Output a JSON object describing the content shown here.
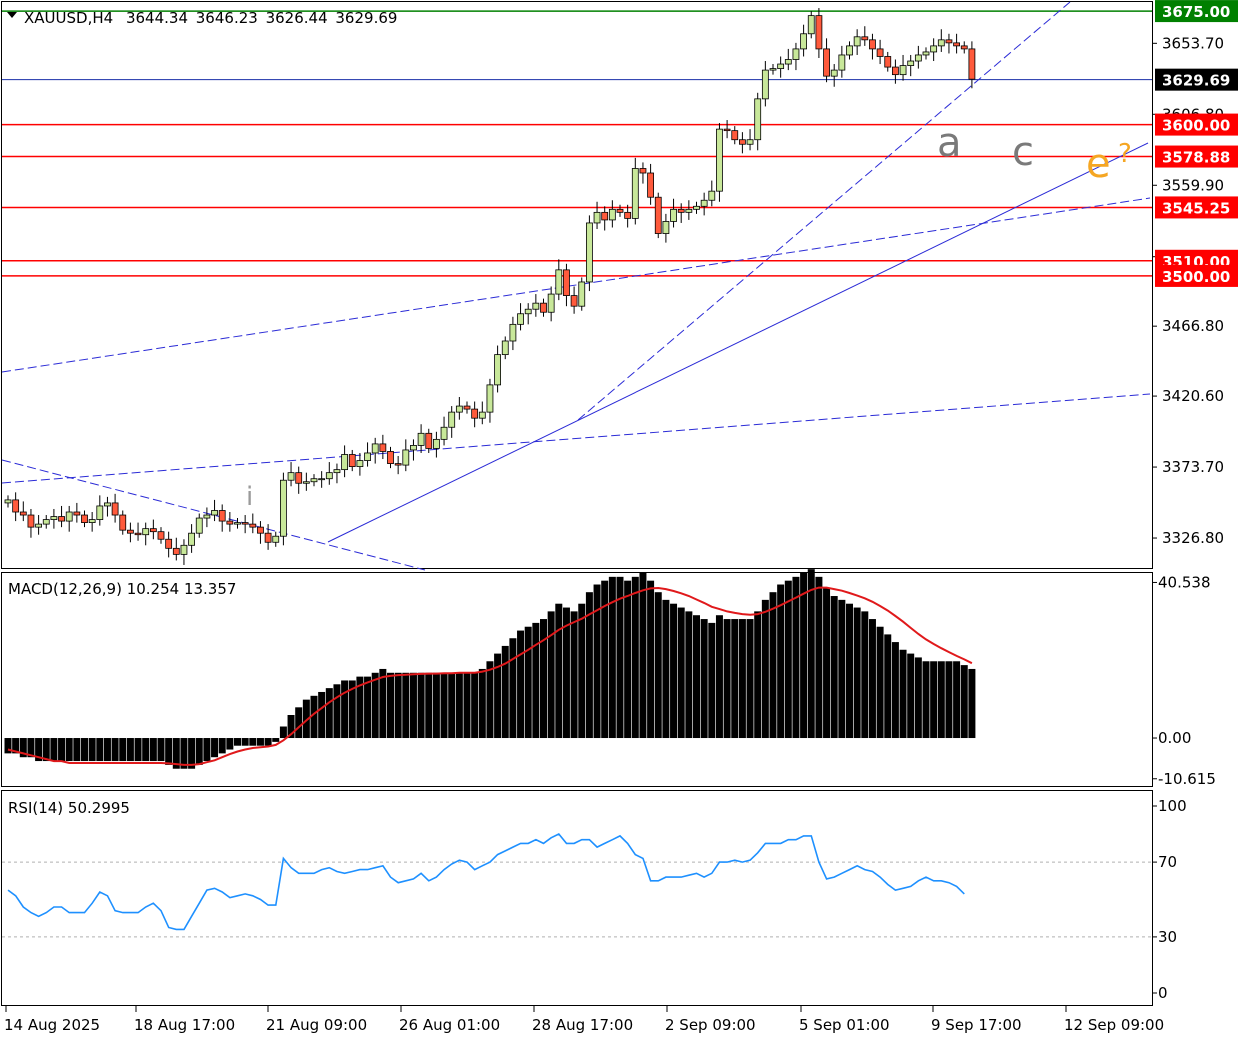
{
  "header": {
    "symbol": "XAUUSD,H4",
    "open": "3644.34",
    "high": "3646.23",
    "low": "3626.44",
    "close": "3629.69"
  },
  "macd_label": "MACD(12,26,9) 10.254 13.357",
  "rsi_label": "RSI(14) 50.2995",
  "chart_data": [
    {
      "type": "candlestick",
      "title": "XAUUSD,H4",
      "ylim": [
        3307,
        3681
      ],
      "y_ticks": [
        "3653.70",
        "3606.80",
        "3559.90",
        "3512.70",
        "3466.80",
        "3420.60",
        "3373.70",
        "3326.80"
      ],
      "x_ticks": [
        "14 Aug 2025",
        "18 Aug 17:00",
        "21 Aug 09:00",
        "26 Aug 01:00",
        "28 Aug 17:00",
        "2 Sep 09:00",
        "5 Sep 01:00",
        "9 Sep 17:00",
        "12 Sep 09:00"
      ],
      "current_price": "3629.69",
      "levels": [
        {
          "label": "3675.00",
          "value": 3675.0,
          "color": "#008000"
        },
        {
          "label": "3600.00",
          "value": 3600.0,
          "color": "#ff0000"
        },
        {
          "label": "3578.88",
          "value": 3578.88,
          "color": "#ff0000"
        },
        {
          "label": "3545.25",
          "value": 3545.25,
          "color": "#ff0000"
        },
        {
          "label": "3510.00",
          "value": 3510.0,
          "color": "#ff0000"
        },
        {
          "label": "3500.00",
          "value": 3500.0,
          "color": "#ff0000"
        }
      ],
      "wave_labels": [
        "i",
        "a",
        "c",
        "e",
        "?"
      ],
      "close_series": [
        3352,
        3344,
        3342,
        3334,
        3336,
        3339,
        3341,
        3338,
        3344,
        3342,
        3337,
        3339,
        3348,
        3350,
        3342,
        3332,
        3330,
        3329,
        3333,
        3331,
        3326,
        3320,
        3316,
        3322,
        3330,
        3340,
        3342,
        3345,
        3338,
        3336,
        3337,
        3336,
        3334,
        3330,
        3324,
        3328,
        3365,
        3370,
        3363,
        3364,
        3366,
        3366,
        3370,
        3372,
        3382,
        3374,
        3378,
        3383,
        3389,
        3384,
        3376,
        3375,
        3385,
        3388,
        3396,
        3386,
        3392,
        3400,
        3410,
        3414,
        3412,
        3406,
        3410,
        3428,
        3448,
        3457,
        3468,
        3475,
        3478,
        3482,
        3476,
        3488,
        3504,
        3487,
        3480,
        3496,
        3535,
        3542,
        3537,
        3544,
        3542,
        3538,
        3571,
        3568,
        3552,
        3528,
        3536,
        3544,
        3542,
        3544,
        3546,
        3550,
        3556,
        3597,
        3596,
        3590,
        3587,
        3590,
        3617,
        3636,
        3637,
        3640,
        3643,
        3650,
        3660,
        3672,
        3650,
        3632,
        3636,
        3646,
        3652,
        3658,
        3656,
        3650,
        3645,
        3638,
        3633,
        3639,
        3642,
        3646,
        3648,
        3652,
        3656,
        3654,
        3652,
        3650,
        3630
      ]
    },
    {
      "type": "bar",
      "title": "MACD(12,26,9)",
      "values_label": "10.254 13.357",
      "ylim": [
        -12.5,
        43
      ],
      "y_ticks": [
        "40.538",
        "0.00",
        "-10.615"
      ],
      "histogram": [
        -4,
        -4,
        -5,
        -5,
        -6,
        -6,
        -6,
        -6,
        -6,
        -6,
        -6,
        -6,
        -6,
        -6,
        -6,
        -6,
        -6,
        -6,
        -6,
        -6,
        -6,
        -7,
        -8,
        -8,
        -8,
        -7,
        -6,
        -5,
        -4,
        -3,
        -2,
        -2,
        -2,
        -2,
        -2,
        -1,
        3,
        6,
        8,
        10,
        11,
        12,
        13,
        14,
        15,
        15,
        16,
        16,
        17,
        18,
        17,
        17,
        17,
        17,
        17,
        17,
        17,
        17,
        17,
        17,
        17,
        17,
        18,
        20,
        22,
        24,
        26,
        28,
        29,
        30,
        31,
        33,
        35,
        34,
        33,
        35,
        38,
        40,
        41,
        42,
        42,
        41,
        42,
        43,
        41,
        38,
        36,
        35,
        34,
        33,
        32,
        31,
        30,
        32,
        31,
        31,
        31,
        31,
        33,
        36,
        38,
        40,
        41,
        42,
        43,
        44,
        42,
        39,
        37,
        36,
        35,
        34,
        33,
        31,
        29,
        27,
        25,
        23,
        22,
        21,
        20,
        20,
        20,
        20,
        20,
        19,
        18
      ],
      "signal": [
        -3,
        -3.5,
        -4,
        -4.5,
        -5,
        -5.5,
        -6,
        -6,
        -6.5,
        -6.5,
        -6.5,
        -6.5,
        -6.5,
        -6.5,
        -6.5,
        -6.5,
        -6.5,
        -6.5,
        -6.5,
        -6.5,
        -6.5,
        -6.6,
        -6.8,
        -7,
        -7,
        -6.8,
        -6.3,
        -5.8,
        -5,
        -4.2,
        -3.5,
        -3,
        -2.6,
        -2.4,
        -2.2,
        -1.8,
        -0.6,
        1,
        2.8,
        4.6,
        6.3,
        7.8,
        9.3,
        10.6,
        11.8,
        12.8,
        13.7,
        14.5,
        15.2,
        15.9,
        16.2,
        16.4,
        16.5,
        16.6,
        16.7,
        16.8,
        16.8,
        16.9,
        16.9,
        17,
        17,
        17,
        17.3,
        17.8,
        18.5,
        19.4,
        20.6,
        21.8,
        23,
        24.3,
        25.5,
        26.8,
        28.2,
        29.3,
        30.2,
        31.1,
        32.2,
        33.3,
        34.4,
        35.4,
        36.3,
        37,
        37.8,
        38.5,
        39,
        39.1,
        38.8,
        38.3,
        37.7,
        37,
        36.1,
        35.2,
        34.2,
        33.6,
        33,
        32.6,
        32.3,
        32.1,
        32.3,
        32.9,
        33.7,
        34.6,
        35.6,
        36.6,
        37.6,
        38.6,
        39.2,
        39.2,
        38.8,
        38.4,
        37.8,
        37.1,
        36.4,
        35.5,
        34.4,
        33.2,
        31.8,
        30.3,
        28.7,
        27.1,
        25.7,
        24.5,
        23.4,
        22.4,
        21.4,
        20.5,
        19.5
      ]
    },
    {
      "type": "line",
      "title": "RSI(14)",
      "value_label": "50.2995",
      "ylim": [
        0,
        100
      ],
      "y_ticks": [
        "100",
        "70",
        "30",
        "0"
      ],
      "levels": [
        70,
        30
      ],
      "values": [
        55,
        52,
        46,
        43,
        41,
        43,
        46,
        46,
        43,
        43,
        43,
        48,
        54,
        52,
        44,
        43,
        43,
        43,
        46,
        48,
        44,
        35,
        34,
        34,
        41,
        48,
        55,
        56,
        54,
        51,
        52,
        53,
        52,
        50,
        47,
        47,
        72,
        67,
        64,
        64,
        64,
        66,
        67,
        65,
        64,
        65,
        66,
        66,
        67,
        68,
        62,
        59,
        60,
        61,
        64,
        60,
        62,
        66,
        69,
        71,
        70,
        66,
        68,
        70,
        74,
        76,
        78,
        80,
        80,
        82,
        80,
        83,
        85,
        80,
        80,
        82,
        82,
        78,
        80,
        82,
        84,
        80,
        74,
        72,
        60,
        60,
        62,
        62,
        62,
        63,
        64,
        62,
        64,
        70,
        70,
        71,
        70,
        71,
        75,
        80,
        80,
        80,
        82,
        82,
        84,
        84,
        70,
        61,
        62,
        64,
        66,
        68,
        66,
        65,
        62,
        58,
        55,
        56,
        57,
        60,
        62,
        60,
        60,
        59,
        57,
        53
      ]
    }
  ]
}
